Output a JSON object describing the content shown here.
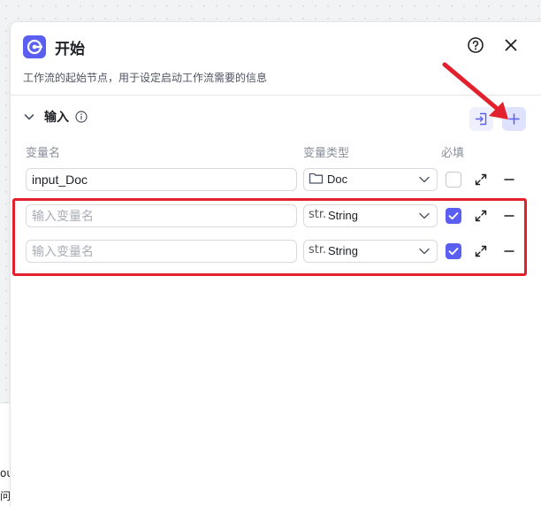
{
  "panel": {
    "title": "开始",
    "description": "工作流的起始节点，用于设定启动工作流需要的信息",
    "icons": {
      "logo": "play-node-icon",
      "help": "question-circle-icon",
      "close": "close-icon"
    }
  },
  "section": {
    "title": "输入",
    "icons": {
      "collapse": "chevron-down-icon",
      "info": "info-circle-icon",
      "import": "import-icon",
      "add": "plus-icon"
    }
  },
  "columns": {
    "name": "变量名",
    "type": "变量类型",
    "required": "必填"
  },
  "rows": [
    {
      "name_value": "input_Doc",
      "name_placeholder": "",
      "type_prefix": "",
      "type_icon": "folder-icon",
      "type_label": "Doc",
      "required": false
    },
    {
      "name_value": "",
      "name_placeholder": "输入变量名",
      "type_prefix": "str.",
      "type_icon": "string-type-icon",
      "type_label": "String",
      "required": true
    },
    {
      "name_value": "",
      "name_placeholder": "输入变量名",
      "type_prefix": "str.",
      "type_icon": "string-type-icon",
      "type_label": "String",
      "required": true
    }
  ],
  "background_fragments": [
    "ou",
    "问题"
  ],
  "colors": {
    "accent": "#5a5ff2",
    "highlight": "#e3202d",
    "arrow": "#e3202d"
  }
}
